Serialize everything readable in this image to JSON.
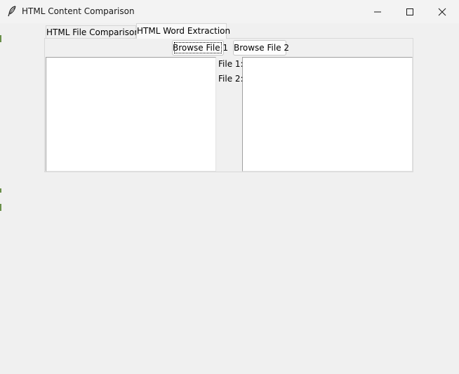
{
  "window": {
    "title": "HTML Content Comparison",
    "app_icon": "feather-icon",
    "controls": {
      "minimize": "minimize-icon",
      "maximize": "maximize-icon",
      "close": "close-icon"
    }
  },
  "notebook": {
    "tabs": [
      {
        "label": "HTML File Comparison",
        "selected": false
      },
      {
        "label": "HTML Word Extraction",
        "selected": true
      }
    ]
  },
  "panel": {
    "browse_file_1_label": "Browse File 1",
    "browse_file_2_label": "Browse File 2",
    "file_1_label": "File 1:",
    "file_2_label": "File 2:",
    "text_area_1_content": "",
    "text_area_2_content": ""
  }
}
